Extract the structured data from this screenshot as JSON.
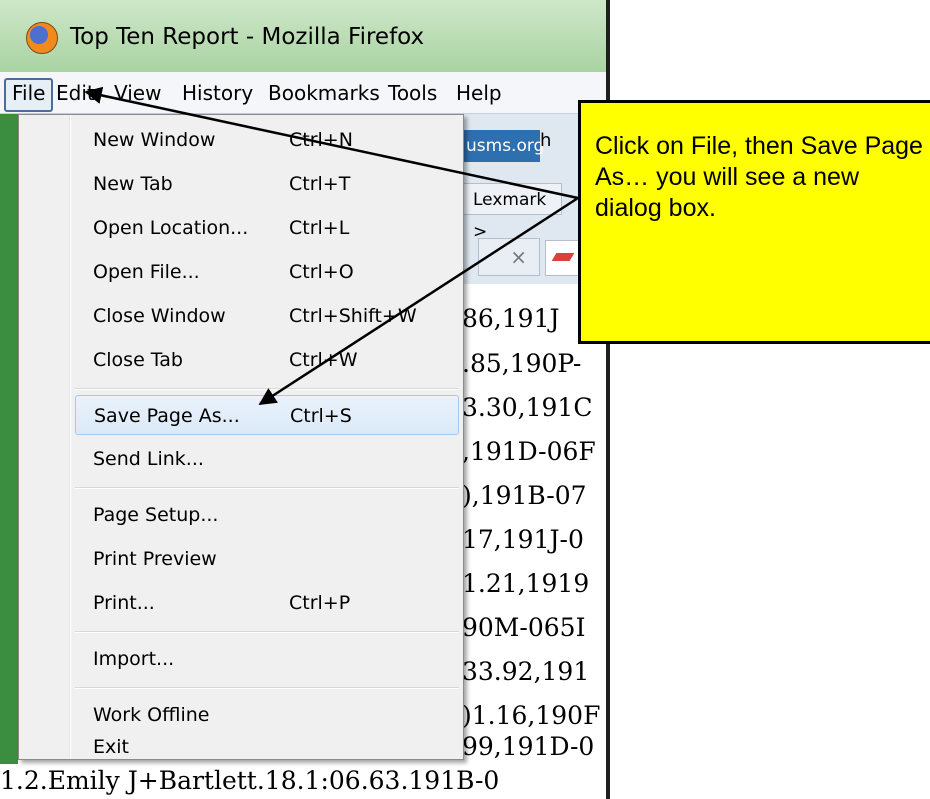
{
  "window": {
    "title": "Top Ten Report - Mozilla Firefox"
  },
  "menubar": {
    "items": [
      {
        "label": "File"
      },
      {
        "label": "Edit"
      },
      {
        "label": "View"
      },
      {
        "label": "History"
      },
      {
        "label": "Bookmarks"
      },
      {
        "label": "Tools"
      },
      {
        "label": "Help"
      }
    ]
  },
  "file_menu": {
    "items": [
      {
        "label": "New Window",
        "shortcut": "Ctrl+N"
      },
      {
        "label": "New Tab",
        "shortcut": "Ctrl+T"
      },
      {
        "label": "Open Location...",
        "shortcut": "Ctrl+L"
      },
      {
        "label": "Open File...",
        "shortcut": "Ctrl+O"
      },
      {
        "label": "Close Window",
        "shortcut": "Ctrl+Shift+W"
      },
      {
        "label": "Close Tab",
        "shortcut": "Ctrl+W"
      },
      {
        "label": "Save Page As...",
        "shortcut": "Ctrl+S"
      },
      {
        "label": "Send Link...",
        "shortcut": ""
      },
      {
        "label": "Page Setup...",
        "shortcut": ""
      },
      {
        "label": "Print Preview",
        "shortcut": ""
      },
      {
        "label": "Print...",
        "shortcut": "Ctrl+P"
      },
      {
        "label": "Import...",
        "shortcut": ""
      },
      {
        "label": "Work Offline",
        "shortcut": ""
      },
      {
        "label": "Exit",
        "shortcut": ""
      }
    ]
  },
  "toolbar": {
    "url_chip": "usms.org",
    "url_suffix": "h",
    "bookmark": "Lexmark >",
    "tab_close": "×"
  },
  "page_rows": [
    "86,191J",
    ".85,190P-",
    "3.30,191C",
    ",191D-06F",
    "),191B-07",
    "17,191J-0",
    "1.21,1919",
    "90M-065I",
    "33.92,191",
    ")1.16,190F",
    "99,191D-0"
  ],
  "page_bottom_row": "1.2.Emily J+Bartlett.18.1:06.63.191B-0",
  "callout": {
    "text": "Click on File, then Save Page As… you will see a new dialog box."
  },
  "colors": {
    "callout_bg": "#ffff00",
    "titlebar": "#b6dbb0",
    "menu_hover": "#dbe9f8"
  }
}
